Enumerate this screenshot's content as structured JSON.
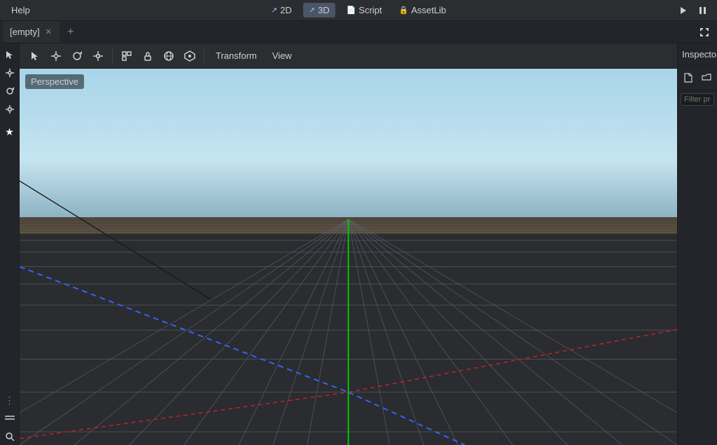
{
  "menubar": {
    "items": [
      {
        "label": "Help",
        "id": "help"
      }
    ],
    "mode_2d": {
      "label": "2D",
      "icon": "↗"
    },
    "mode_3d": {
      "label": "3D",
      "icon": "↗",
      "active": true
    },
    "script": {
      "label": "Script",
      "icon": "📄"
    },
    "assetlib": {
      "label": "AssetLib",
      "icon": "🔒"
    }
  },
  "tabbar": {
    "tab": {
      "label": "[empty]"
    },
    "add_label": "+",
    "fullscreen_title": "fullscreen"
  },
  "toolbar": {
    "tools": [
      "select",
      "move",
      "rotate",
      "scale",
      "transform_select",
      "lock",
      "mesh",
      "snap"
    ],
    "transform_label": "Transform",
    "view_label": "View"
  },
  "viewport": {
    "perspective_label": "Perspective",
    "accent_green": "#00ff00",
    "accent_blue": "#4488ff",
    "accent_red": "#ff4444",
    "grid_color": "#404040",
    "sky_top": "#a8d4e8",
    "sky_bottom": "#8ab0c0",
    "ground_color": "#4a4035"
  },
  "inspector": {
    "title": "Inspector",
    "filter_placeholder": "Filter pro",
    "icons": [
      "file",
      "folder"
    ]
  }
}
